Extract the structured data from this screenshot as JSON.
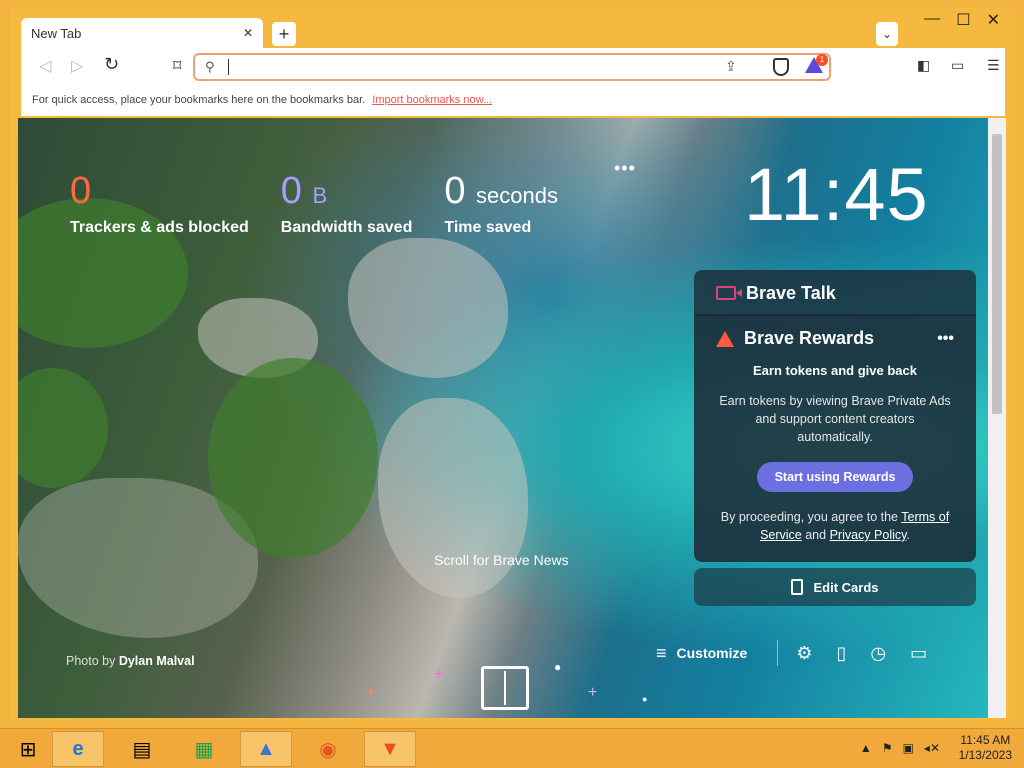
{
  "window": {
    "tab_title": "New Tab",
    "tab_close": "✕",
    "new_tab": "+",
    "tab_list": "⌄",
    "controls": {
      "minimize": "—",
      "maximize": "☐",
      "close": "✕"
    }
  },
  "toolbar": {
    "back": "◁",
    "forward": "▷",
    "reload": "↻",
    "bookmark": "⌑",
    "search_placeholder": "",
    "rewards_badge": "1",
    "sidebar": "◧",
    "wallet": "▭",
    "menu": "☰"
  },
  "bookmarks_bar": {
    "prompt": "For quick access, place your bookmarks here on the bookmarks bar.",
    "import_link": "Import bookmarks now..."
  },
  "stats": {
    "trackers": {
      "value": "0",
      "label": "Trackers & ads blocked"
    },
    "bandwidth": {
      "value": "0",
      "unit": "B",
      "label": "Bandwidth saved"
    },
    "time": {
      "value": "0",
      "unit": "seconds",
      "label": "Time saved"
    },
    "more": "•••"
  },
  "clock": "11:45",
  "cards": {
    "talk_title": "Brave Talk",
    "rewards_title": "Brave Rewards",
    "rewards_more": "•••",
    "rewards_tagline": "Earn tokens and give back",
    "rewards_desc": "Earn tokens by viewing Brave Private Ads and support content creators automatically.",
    "rewards_button": "Start using Rewards",
    "legal_prefix": "By proceeding, you agree to the",
    "terms": "Terms of Service",
    "legal_and": "and",
    "privacy": "Privacy Policy",
    "legal_suffix": ".",
    "edit_cards": "Edit Cards"
  },
  "photo_credit": {
    "prefix": "Photo by",
    "author": "Dylan Malval"
  },
  "scroll_news": "Scroll for Brave News",
  "bottom_bar": {
    "customize": "Customize"
  },
  "taskbar": {
    "time": "11:45 AM",
    "date": "1/13/2023"
  },
  "colors": {
    "accent": "#ff6a3d",
    "rewards_button": "#6b6fe0",
    "taskbar": "#f0a93a"
  }
}
